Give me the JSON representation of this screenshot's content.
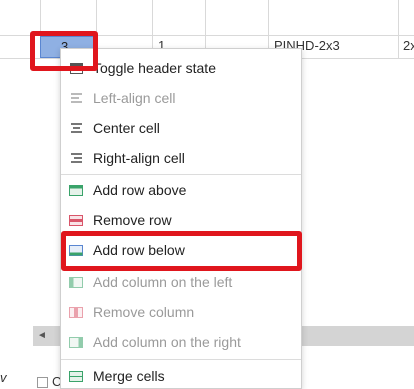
{
  "grid": {
    "selected_cell_value": "3",
    "cell_b": "1",
    "cell_c": "PINHD-2x3",
    "cell_d": "2x"
  },
  "bottom": {
    "scroll_arrow": "◄",
    "stray_char": "v",
    "checkbox_label": "C"
  },
  "menu": {
    "items": [
      {
        "label": "Toggle header state",
        "icon": "header-toggle-icon",
        "state": "enabled"
      },
      {
        "label": "Left-align cell",
        "icon": "align-left-icon",
        "state": "disabled"
      },
      {
        "label": "Center cell",
        "icon": "align-center-icon",
        "state": "enabled"
      },
      {
        "label": "Right-align cell",
        "icon": "align-right-icon",
        "state": "enabled"
      },
      {
        "label": "Add row above",
        "icon": "add-row-above-icon",
        "state": "enabled"
      },
      {
        "label": "Remove row",
        "icon": "remove-row-icon",
        "state": "enabled"
      },
      {
        "label": "Add row below",
        "icon": "add-row-below-icon",
        "state": "enabled"
      },
      {
        "label": "Add column on the left",
        "icon": "add-column-left-icon",
        "state": "disabled"
      },
      {
        "label": "Remove column",
        "icon": "remove-column-icon",
        "state": "disabled"
      },
      {
        "label": "Add column on the right",
        "icon": "add-column-right-icon",
        "state": "disabled"
      },
      {
        "label": "Merge cells",
        "icon": "merge-cells-icon",
        "state": "enabled"
      }
    ]
  },
  "colors": {
    "highlight": "#e0161d",
    "selection": "#8fb0e3",
    "add_icon": "#3aa36a",
    "remove_icon": "#d9566a"
  }
}
